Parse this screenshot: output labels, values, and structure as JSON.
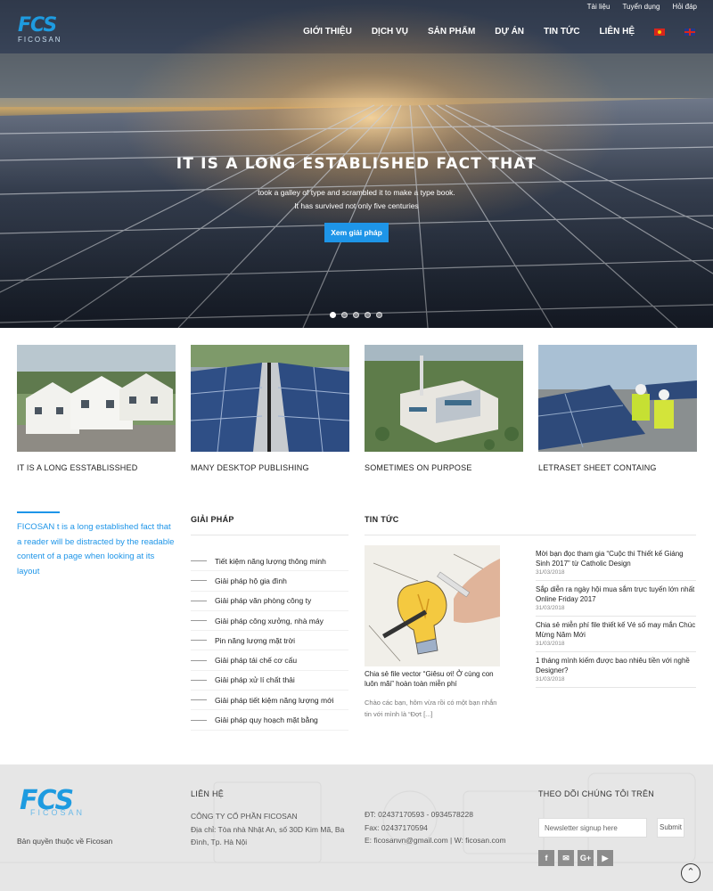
{
  "topbar": {
    "links": [
      "Tài liệu",
      "Tuyển dụng",
      "Hỏi đáp"
    ]
  },
  "logo": {
    "mark": "FCS",
    "sub": "FICOSAN"
  },
  "nav": {
    "items": [
      "GIỚI THIỆU",
      "DỊCH VỤ",
      "SẢN PHẨM",
      "DỰ ÁN",
      "TIN TỨC",
      "LIÊN HỆ"
    ]
  },
  "hero": {
    "title": "IT IS A LONG ESTABLISHED FACT THAT",
    "line1": "took a galley of type and scrambled it to make a type book.",
    "line2": "It has survived not only five centuries",
    "button": "Xem giải pháp",
    "slides": 5,
    "active_slide": 1
  },
  "features": [
    {
      "title": "IT IS A LONG ESSTABLISSHED"
    },
    {
      "title": "MANY DESKTOP PUBLISHING"
    },
    {
      "title": "SOMETIMES ON PURPOSE"
    },
    {
      "title": "LETRASET SHEET CONTAING"
    }
  ],
  "about": {
    "text": "FICOSAN t is a long established fact that a reader will be distracted by the readable content of a page when looking at its layout"
  },
  "solutions": {
    "heading": "GIẢI PHÁP",
    "items": [
      "Tiết kiệm năng lượng thông minh",
      "Giải pháp hộ gia đình",
      "Giải pháp văn phòng công ty",
      "Giải pháp công xưởng, nhà máy",
      "Pin năng lượng mặt trời",
      "Giải pháp tái chế cơ cấu",
      "Giải pháp xử lí chất thải",
      "Giải pháp tiết kiệm năng lượng mới",
      "Giải pháp quy hoạch mặt bằng"
    ]
  },
  "news": {
    "heading": "TIN TỨC",
    "main": {
      "title": "Chia sẻ file vector “Giêsu ơi! Ở cùng con luôn mãi” hoàn toàn miễn phí",
      "excerpt": "Chào các bạn, hôm vừa rồi có một bạn nhắn tin với mình là “Đợt [...]"
    },
    "items": [
      {
        "title": "Mời bạn đọc tham gia “Cuộc thi Thiết kế Giáng Sinh 2017” từ Catholic Design",
        "date": "31/03/2018"
      },
      {
        "title": "Sắp diễn ra ngày hội mua sắm trực tuyến lớn nhất Online Friday 2017",
        "date": "31/03/2018"
      },
      {
        "title": "Chia sẻ miễn phí file thiết kế Vé số may mắn Chúc Mừng Năm Mới",
        "date": "31/03/2018"
      },
      {
        "title": "1 tháng mình kiếm được bao nhiêu tiền với nghề Designer?",
        "date": "31/03/2018"
      }
    ]
  },
  "footer": {
    "copyright": "Bản quyền thuộc về Ficosan",
    "contact_heading": "LIÊN HỆ",
    "company": "CÔNG TY CỔ PHẦN FICOSAN",
    "address": "Địa chỉ: Tòa nhà Nhật An, số 30D Kim Mã, Ba Đình, Tp. Hà Nội",
    "phone": "ĐT: 02437170593 - 0934578228",
    "fax": "Fax: 02437170594",
    "email": "E: ficosanvn@gmail.com | W: ficosan.com",
    "follow_heading": "THEO DÕI CHÚNG TÔI TRÊN",
    "newsletter_placeholder": "Newsletter signup here",
    "submit": "Submit",
    "social_icons": [
      "facebook-icon",
      "email-icon",
      "google-plus-icon",
      "youtube-icon"
    ]
  },
  "colors": {
    "accent": "#1e95e8",
    "logo": "#1e9be0",
    "footer_bg": "#e6e6e6"
  }
}
